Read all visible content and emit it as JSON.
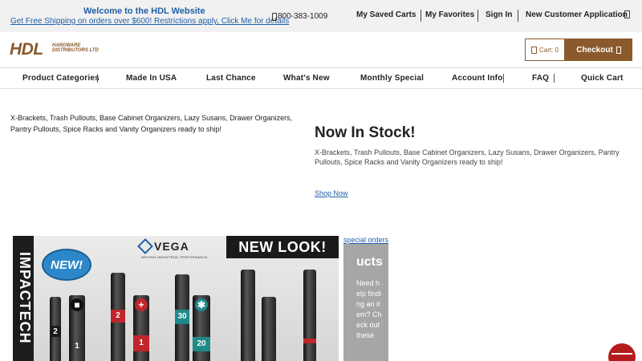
{
  "topbar": {
    "welcome": "Welcome to the HDL Website",
    "shipping": "Get Free Shipping on orders over $600! Restrictions apply, Click Me for details",
    "phone": "800-383-1009",
    "links": {
      "saved_carts": "My Saved Carts",
      "favorites": "My Favorites",
      "sign_in": "Sign In",
      "new_customer": "New Customer Application"
    }
  },
  "logo": {
    "main": "HDL",
    "sub": "HARDWARE DISTRIBUTORS LTD"
  },
  "cart": {
    "label": "Cart: 0",
    "checkout": "Checkout"
  },
  "nav": [
    "Product Categories",
    "Made In USA",
    "Last Chance",
    "What's New",
    "Monthly Special",
    "Account Info",
    "FAQ",
    "Quick Cart"
  ],
  "content": {
    "blurb_left": "X-Brackets, Trash Pullouts, Base Cabinet Organizers, Lazy Susans, Drawer Organizers, Pantry Pullouts, Spice Racks and Vanity Organizers ready to ship!",
    "title": "Now In Stock!",
    "blurb_right": "X-Brackets, Trash Pullouts, Base Cabinet Organizers, Lazy Susans, Drawer Organizers, Pantry Pullouts, Spice Racks and Vanity Organizers ready to ship!",
    "shop_now": "Shop Now"
  },
  "banner": {
    "vertical": "IMPACTECH",
    "brand": "VEGA",
    "tagline": "DRIVING INDUSTRIAL PERFORMANCE",
    "new_look": "NEW LOOK!",
    "badge": "NEW!",
    "bits": [
      {
        "label": "2",
        "band": "#1a1a1a"
      },
      {
        "label": "1",
        "band": "#1a1a1a"
      },
      {
        "label": "2",
        "band": "#c0262c"
      },
      {
        "label": "1",
        "band": "#c0262c"
      },
      {
        "label": "30",
        "band": "#1e8a8a"
      },
      {
        "label": "20",
        "band": "#1e8a8a"
      },
      {
        "label": "",
        "band": "#1a1a1a"
      },
      {
        "label": "",
        "band": "#1a1a1a"
      },
      {
        "label": "",
        "band": "#1a1a1a"
      }
    ]
  },
  "side": {
    "link": "special orders",
    "heading": "ucts",
    "text": "Need help finding an item? Check out these"
  },
  "colors": {
    "brand_brown": "#8a5a2c",
    "link_blue": "#1f5fa8",
    "topbar_bg": "#f1f1f1"
  },
  "icons": {
    "phone": "phone-icon",
    "doc": "document-icon",
    "bag": "shopping-bag-icon",
    "chat": "chat-icon"
  }
}
